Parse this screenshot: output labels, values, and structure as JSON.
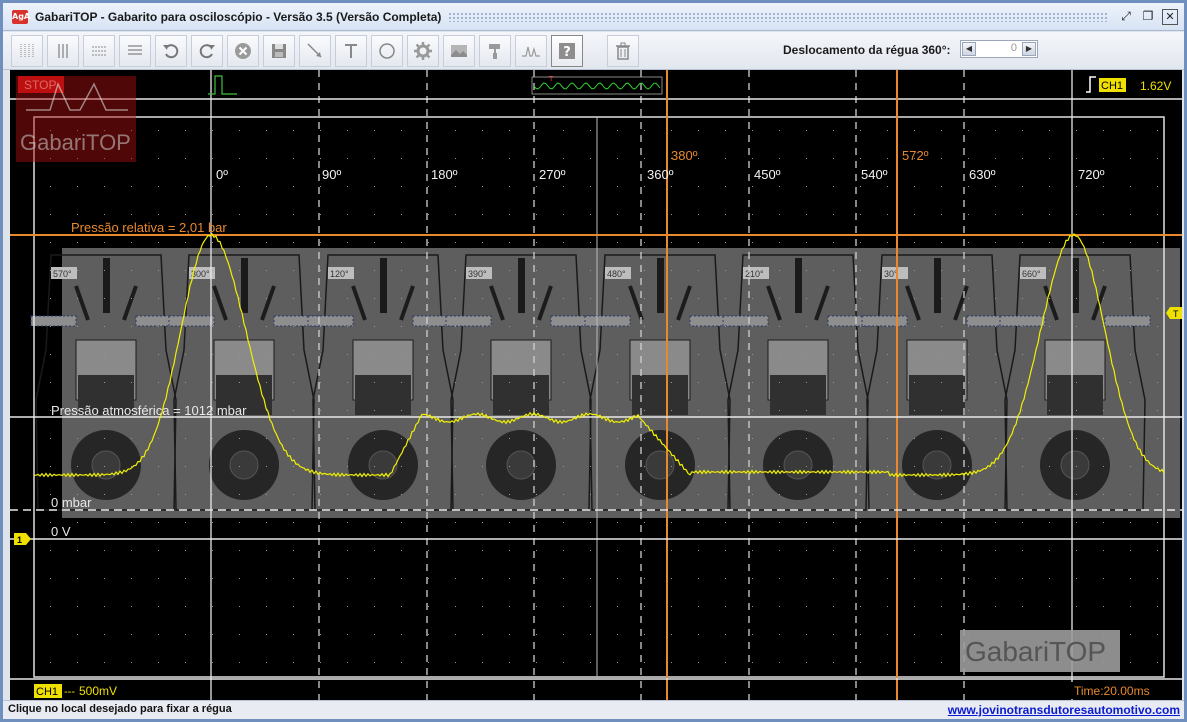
{
  "window": {
    "app_icon_text": "AgA",
    "title": "GabariTOP - Gabarito para osciloscópio - Versão 3.5 (Versão Completa)"
  },
  "toolbar": {
    "buttons": [
      "grid-vertical-icon",
      "grid-vertical-2-icon",
      "grid-horizontal-dashed-icon",
      "grid-horizontal-icon",
      "undo-icon",
      "redo-icon",
      "delete-icon",
      "save-icon",
      "line-tool-icon",
      "text-tool-icon",
      "circle-tool-icon",
      "settings-icon",
      "image-icon",
      "paint-icon",
      "waveform-icon",
      "help-icon",
      "trash-icon"
    ],
    "ruler_label": "Deslocamento da régua 360°:",
    "ruler_value": "0"
  },
  "scope": {
    "stop_label": "STOP",
    "channel_label": "CH1",
    "trigger_level": "1.62V",
    "logo_text": "GabariTOP",
    "watermark_text": "GabariTOP",
    "angle_labels": [
      "0º",
      "90º",
      "180º",
      "270º",
      "360º",
      "450º",
      "540º",
      "630º",
      "720º"
    ],
    "cursor_labels": [
      "380º",
      "572º"
    ],
    "pressure_relative_label": "Pressão relativa = 2,01 bar",
    "pressure_atm_label": "Pressão atmosférica = 1012 mbar",
    "zero_mbar_label": "0 mbar",
    "zero_v_label": "0 V",
    "ch1_scale_channel": "CH1",
    "ch1_scale_value": "500mV",
    "time_label": "Time:20.00ms",
    "engine_angles": [
      "570°",
      "300°",
      "120°",
      "390°",
      "480°",
      "210°",
      "30°",
      "660°"
    ],
    "colors": {
      "trace": "#f0f000",
      "cursor": "#e8892e",
      "grid": "#d9d9d9",
      "stop_bg": "#c81010",
      "ch1_bg": "#f0e000"
    }
  },
  "status": {
    "message": "Clique no local desejado para fixar a régua",
    "link": "www.jovinotransdutoresautomotivo.com"
  }
}
